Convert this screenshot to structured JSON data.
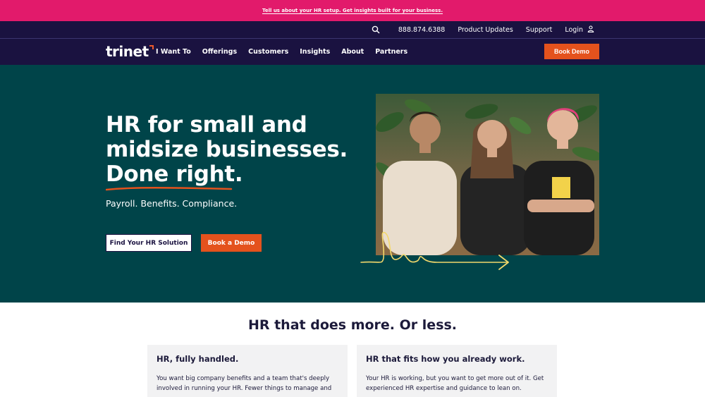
{
  "promo": {
    "text": "Tell us about your HR setup. Get insights built for your business."
  },
  "utility": {
    "search_icon": "search-icon",
    "phone": "888.874.6388",
    "product_updates": "Product Updates",
    "support": "Support",
    "login": "Login",
    "login_icon": "user-icon"
  },
  "nav": {
    "logo_text": "trinet",
    "items": [
      "I Want To",
      "Offerings",
      "Customers",
      "Insights",
      "About",
      "Partners"
    ],
    "cta": "Book Demo"
  },
  "hero": {
    "title_lines": [
      "HR for small and",
      "midsize businesses.",
      "Done right."
    ],
    "subtitle": "Payroll. Benefits. Compliance.",
    "primary_button": "Find Your HR Solution",
    "secondary_button": "Book a Demo",
    "photo_alt": "Three smiling women standing in front of plants",
    "colors": {
      "background": "#004449",
      "accent": "#e4521d",
      "underline": "#e4521d",
      "arrow": "#f3d86b"
    }
  },
  "section": {
    "title_strong": "HR that does more.",
    "title_light": "Or less.",
    "cards": [
      {
        "title": "HR, fully handled.",
        "body": "You want big company benefits and a team that's deeply involved in running your HR. Fewer things to manage and"
      },
      {
        "title": "HR that fits how you already work.",
        "body": "Your HR is working, but you want to get more out of it. Get experienced HR expertise and guidance to lean on."
      }
    ]
  }
}
